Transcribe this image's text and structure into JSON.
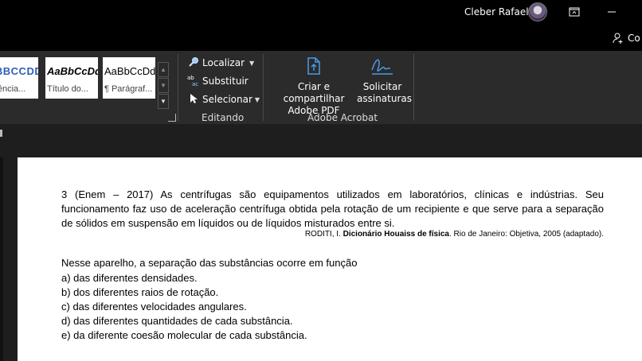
{
  "titlebar": {
    "user_name": "Cleber Rafael"
  },
  "sharebar": {
    "share_label": "Co"
  },
  "ribbon": {
    "styles": [
      {
        "sample": "ABBCCDD",
        "label": "ferência..."
      },
      {
        "sample": "AaBbCcDd",
        "label": "Título do..."
      },
      {
        "sample": "AaBbCcDd",
        "label": "¶ Parágraf..."
      }
    ],
    "editing": {
      "find": "Localizar",
      "replace": "Substituir",
      "select": "Selecionar",
      "group_label": "Editando"
    },
    "acrobat": {
      "create_line1": "Criar e compartilhar",
      "create_line2": "Adobe PDF",
      "sign_line1": "Solicitar",
      "sign_line2": "assinaturas",
      "group_label": "Adobe Acrobat"
    }
  },
  "document": {
    "question": "3 (Enem – 2017) As centrífugas são equipamentos utilizados em laboratórios, clínicas e indústrias. Seu funcionamento faz uso de aceleração centrífuga obtida pela rotação de um recipiente e que serve para a separação de sólidos em suspensão em líquidos ou de líquidos misturados entre si.",
    "source_author": "RODITI, I. ",
    "source_title": "Dicionário Houaiss de física",
    "source_rest": ". Rio de Janeiro: Objetiva, 2005 (adaptado).",
    "prompt": "Nesse aparelho, a separação das substâncias ocorre em função",
    "options": [
      "a) das diferentes densidades.",
      "b) dos diferentes raios de rotação.",
      "c) das diferentes velocidades angulares.",
      "d) das diferentes quantidades de cada substância.",
      "e) da diferente coesão molecular de cada substância."
    ]
  }
}
